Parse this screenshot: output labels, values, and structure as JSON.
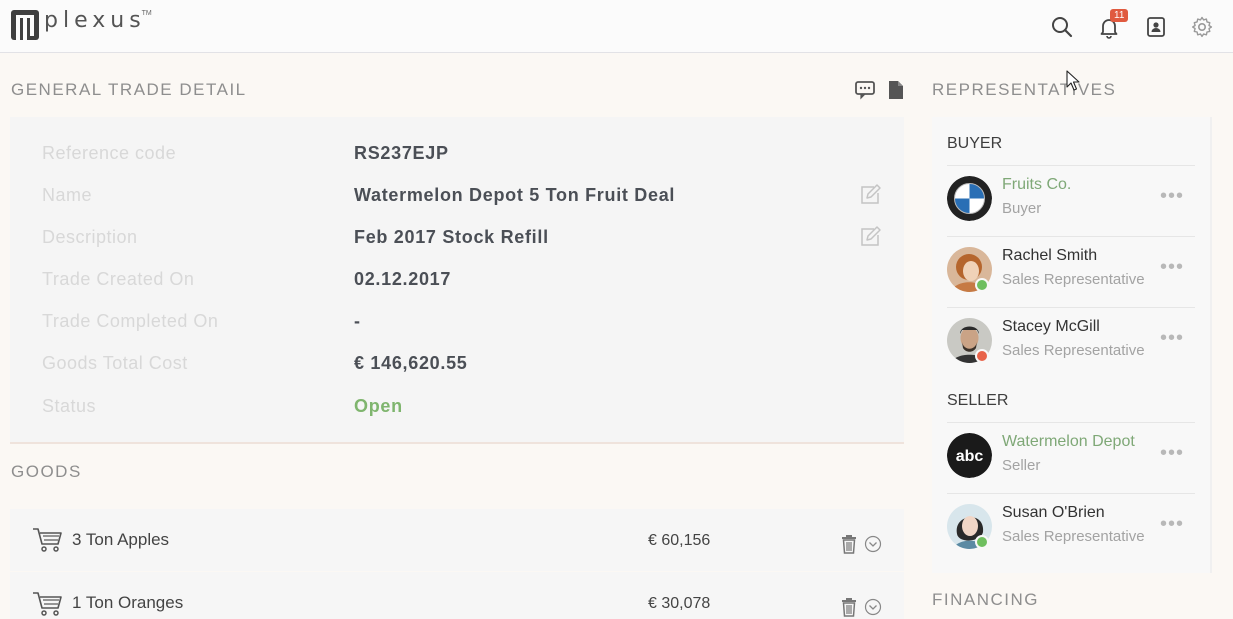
{
  "app": {
    "logo_text": "plexus",
    "logo_tm": "TM",
    "notification_count": "11"
  },
  "colors": {
    "accent_green": "#7fb56e",
    "badge_red": "#e05a3f",
    "status_online": "#6fbf5f",
    "status_busy": "#e8634a"
  },
  "icons": {
    "top": [
      "search-icon",
      "bell-icon",
      "contacts-icon",
      "gear-icon"
    ]
  },
  "trade": {
    "section_title": "GENERAL TRADE DETAIL",
    "rows": [
      {
        "label": "Reference code",
        "value": "RS237EJP",
        "editable": false
      },
      {
        "label": "Name",
        "value": "Watermelon Depot 5 Ton Fruit Deal",
        "editable": true
      },
      {
        "label": "Description",
        "value": "Feb 2017 Stock Refill",
        "editable": true
      },
      {
        "label": "Trade Created On",
        "value": "02.12.2017",
        "editable": false
      },
      {
        "label": "Trade Completed On",
        "value": "-",
        "editable": false
      },
      {
        "label": "Goods Total Cost",
        "value": "€ 146,620.55",
        "editable": false
      },
      {
        "label": "Status",
        "value": "Open",
        "editable": false
      }
    ]
  },
  "goods": {
    "section_title": "GOODS",
    "items": [
      {
        "name": "3 Ton Apples",
        "price": "€ 60,156"
      },
      {
        "name": "1 Ton Oranges",
        "price": "€ 30,078"
      }
    ]
  },
  "representatives": {
    "section_title": "REPRESENTATIVES",
    "buyer_label": "BUYER",
    "seller_label": "SELLER",
    "buyer": [
      {
        "name": "Fruits Co.",
        "role": "Buyer",
        "company": true,
        "avatar": "bmw-logo"
      },
      {
        "name": "Rachel Smith",
        "role": "Sales Representative",
        "company": false,
        "status": "online",
        "avatar": "person-avatar"
      },
      {
        "name": "Stacey McGill",
        "role": "Sales Representative",
        "company": false,
        "status": "busy",
        "avatar": "person-avatar"
      }
    ],
    "seller": [
      {
        "name": "Watermelon Depot",
        "role": "Seller",
        "company": true,
        "avatar": "abc-logo"
      },
      {
        "name": "Susan O'Brien",
        "role": "Sales Representative",
        "company": false,
        "status": "online",
        "avatar": "person-avatar"
      }
    ]
  },
  "financing": {
    "section_title": "FINANCING"
  }
}
